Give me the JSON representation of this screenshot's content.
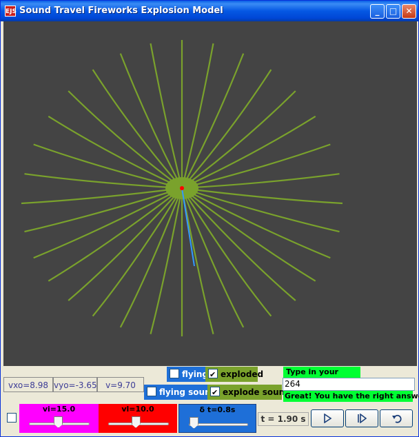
{
  "window": {
    "title": "Sound Travel Fireworks Explosion Model",
    "app_icon_text": "EJS",
    "buttons": {
      "minimize": "_",
      "maximize": "□",
      "close": "✕"
    }
  },
  "canvas": {
    "background": "#444444",
    "trail_color": "#7aa22c",
    "center_color": "#ff0000",
    "sound_line_color": "#3399ff"
  },
  "readouts": {
    "vxo": "vxo=8.98",
    "vyo": "vyo=-3.65",
    "v": "v=9.70"
  },
  "checkboxes": {
    "flying": {
      "label": "flying",
      "checked": false
    },
    "exploded": {
      "label": "exploded",
      "checked": true
    },
    "flying_sound": {
      "label": "flying sound",
      "checked": false
    },
    "explode_sound": {
      "label": "explode sound",
      "checked": true
    }
  },
  "input": {
    "prompt": "Type in your value !",
    "value": "264",
    "feedback": "Great! You have the right answer!"
  },
  "sliders": {
    "vi": {
      "label": "vi=15.0",
      "level": 0.48,
      "color": "#ff00ff"
    },
    "vl": {
      "label": "vl=10.0",
      "level": 0.45,
      "color": "#ff0000"
    },
    "dt": {
      "label": "δ t=0.8s",
      "level": 0.08,
      "color": "#1e6fd8"
    }
  },
  "time": {
    "label": "t = 1.90 s"
  },
  "controls": {
    "play": "play-icon",
    "step": "step-icon",
    "reset": "reset-icon"
  }
}
